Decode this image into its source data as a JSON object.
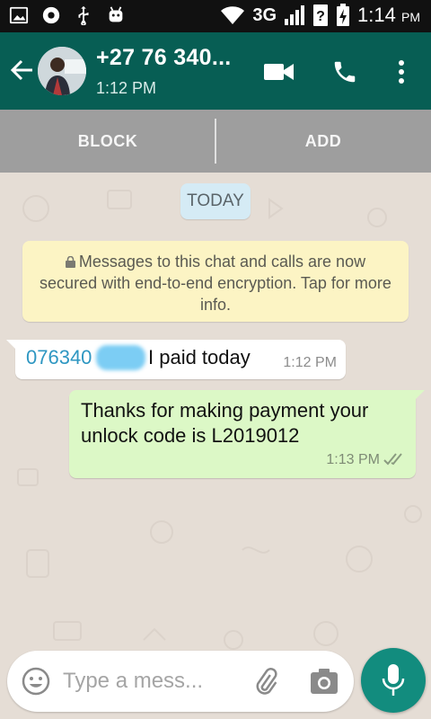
{
  "status_bar": {
    "network": "3G",
    "time": "1:14",
    "time_suffix": "PM",
    "left_icons": [
      "image-icon",
      "record-icon",
      "usb-icon",
      "android-icon"
    ],
    "right_icons": [
      "wifi-icon",
      "signal-icon",
      "sim-unknown-icon",
      "battery-charging-icon"
    ]
  },
  "header": {
    "contact_name": "+27 76 340...",
    "last_seen": "1:12 PM",
    "icons": [
      "back-arrow-icon",
      "video-call-icon",
      "phone-icon",
      "more-vert-icon"
    ],
    "color": "#075e54"
  },
  "action_bar": {
    "block_label": "BLOCK",
    "add_label": "ADD"
  },
  "chat": {
    "date_chip": "TODAY",
    "encryption_notice": "Messages to this chat and calls are now secured with end-to-end encryption. Tap for more info.",
    "messages": [
      {
        "direction": "incoming",
        "sender": "076340",
        "text": "I paid today",
        "time": "1:12 PM"
      },
      {
        "direction": "outgoing",
        "text": "Thanks for making payment your unlock code is L2019012",
        "time": "1:13 PM",
        "status": "delivered"
      }
    ]
  },
  "composer": {
    "placeholder": "Type a mess...",
    "icons": [
      "emoji-icon",
      "attach-icon",
      "camera-icon",
      "mic-icon"
    ]
  },
  "colors": {
    "header": "#075e54",
    "outgoing_bubble": "#dcf8c6",
    "chat_background": "#e5ddd5",
    "mic_button": "#128c7e",
    "encryption_note": "#fcf4c4"
  }
}
